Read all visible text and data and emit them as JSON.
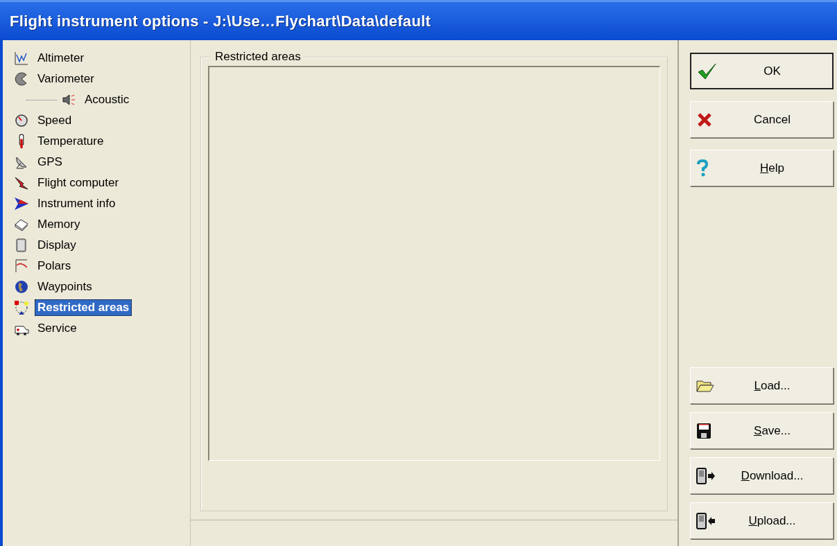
{
  "window": {
    "title": "Flight instrument options - J:\\Use…Flychart\\Data\\default"
  },
  "tree": [
    {
      "label": "Altimeter",
      "selected": false
    },
    {
      "label": "Variometer",
      "selected": false,
      "children": [
        {
          "label": "Acoustic",
          "selected": false
        }
      ]
    },
    {
      "label": "Speed",
      "selected": false
    },
    {
      "label": "Temperature",
      "selected": false
    },
    {
      "label": "GPS",
      "selected": false
    },
    {
      "label": "Flight computer",
      "selected": false
    },
    {
      "label": "Instrument info",
      "selected": false
    },
    {
      "label": "Memory",
      "selected": false
    },
    {
      "label": "Display",
      "selected": false
    },
    {
      "label": "Polars",
      "selected": false
    },
    {
      "label": "Waypoints",
      "selected": false
    },
    {
      "label": "Restricted areas",
      "selected": true
    },
    {
      "label": "Service",
      "selected": false
    }
  ],
  "panel": {
    "legend": "Restricted areas"
  },
  "buttons_top": [
    {
      "rest": "OK",
      "default": true
    },
    {
      "rest": "Cancel",
      "default": false
    },
    {
      "mnemonic": "H",
      "rest": "elp",
      "default": false
    }
  ],
  "buttons_bottom": [
    {
      "mnemonic": "L",
      "rest": "oad...",
      "default": false
    },
    {
      "mnemonic": "S",
      "rest": "ave...",
      "default": false
    },
    {
      "mnemonic": "D",
      "rest": "ownload...",
      "default": false
    },
    {
      "mnemonic": "U",
      "rest": "pload...",
      "default": false
    }
  ]
}
